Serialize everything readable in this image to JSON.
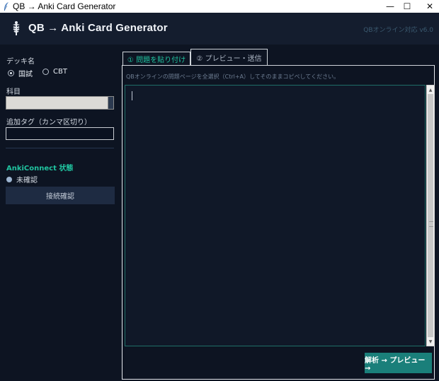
{
  "window": {
    "title": "QB → Anki Card Generator",
    "controls": {
      "minimize": "—",
      "maximize": "☐",
      "close": "✕"
    }
  },
  "header": {
    "title": "QB → Anki Card Generator",
    "version": "QBオンライン対応 v6.0",
    "logo_icon": "caduceus-icon"
  },
  "sidebar": {
    "deck_label": "デッキ名",
    "deck_options": [
      {
        "label": "国試",
        "selected": true
      },
      {
        "label": "CBT",
        "selected": false
      }
    ],
    "subject_label": "科目",
    "subject_value": "",
    "tags_label": "追加タグ（カンマ区切り）",
    "tags_value": "",
    "ankiconnect_title": "AnkiConnect 状態",
    "status_text": "未確認",
    "connect_button": "接続確認"
  },
  "tabs": [
    {
      "label": "① 問題を貼り付け",
      "active": true
    },
    {
      "label": "② プレビュー・送信",
      "active": false
    }
  ],
  "main": {
    "hint": "QBオンラインの問題ページを全選択（Ctrl+A）してそのままコピペしてください。",
    "editor_value": "",
    "submit_button": "解析 → プレビュー →"
  },
  "colors": {
    "accent": "#20c4a0",
    "background": "#0d1422",
    "header": "#141d2e",
    "button_primary": "#1a7f7a",
    "button_secondary": "#1e2b42"
  }
}
